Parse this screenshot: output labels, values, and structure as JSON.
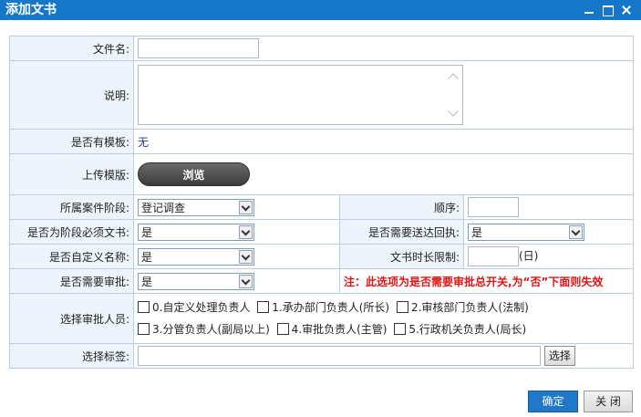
{
  "dialog": {
    "title": "添加文书",
    "controls": {
      "minimize": "minimize-icon",
      "maximize": "maximize-icon",
      "close": "close-icon"
    }
  },
  "form": {
    "filename": {
      "label": "文件名:",
      "value": ""
    },
    "description": {
      "label": "说明:",
      "value": ""
    },
    "has_template": {
      "label": "是否有模板:",
      "value": "无"
    },
    "upload_template": {
      "label": "上传模版:",
      "button": "浏览"
    },
    "case_stage": {
      "label": "所属案件阶段:",
      "value": "登记调查"
    },
    "order": {
      "label": "顺序:",
      "value": ""
    },
    "stage_required": {
      "label": "是否为阶段必须文书:",
      "value": "是"
    },
    "need_receipt": {
      "label": "是否需要送达回执:",
      "value": "是"
    },
    "custom_name": {
      "label": "是否自定义名称:",
      "value": "是"
    },
    "time_limit": {
      "label": "文书时长限制:",
      "value": "",
      "unit": "(日)"
    },
    "need_approval": {
      "label": "是否需要审批:",
      "value": "是",
      "note": "注：此选项为是否需要审批总开关,为“否”下面则失效"
    },
    "approvers": {
      "label": "选择审批人员:",
      "options": [
        {
          "text": "0.自定义处理负责人",
          "checked": false
        },
        {
          "text": "1.承办部门负责人(所长)",
          "checked": false
        },
        {
          "text": "2.审核部门负责人(法制)",
          "checked": false
        },
        {
          "text": "3.分管负责人(副局以上)",
          "checked": false
        },
        {
          "text": "4.审批负责人(主管)",
          "checked": false
        },
        {
          "text": "5.行政机关负责人(局长)",
          "checked": false
        }
      ]
    },
    "tags": {
      "label": "选择标签:",
      "value": "",
      "button": "选择"
    }
  },
  "footer": {
    "ok": "确定",
    "close": "关 闭"
  },
  "colors": {
    "titlebar": "#1577c9",
    "label_bg": "#eef4fb",
    "border": "#bccbe0",
    "note": "#e01515",
    "ok_button": "#1f78c8"
  }
}
